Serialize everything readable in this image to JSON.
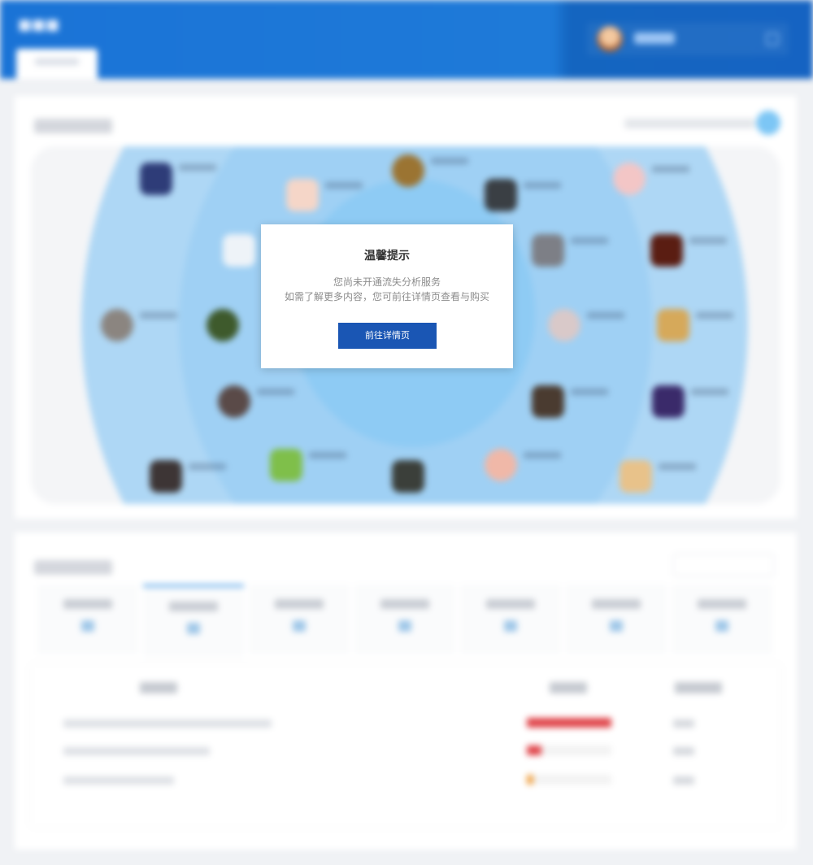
{
  "modal": {
    "title": "温馨提示",
    "message_line1": "您尚未开通流失分析服务",
    "message_line2": "如需了解更多内容，您可前往详情页查看与购买",
    "button_label": "前往详情页"
  },
  "colors": {
    "header_blue": "#1a73d6",
    "modal_button": "#1a56b4",
    "ring_blue": "#9fd0f4"
  }
}
